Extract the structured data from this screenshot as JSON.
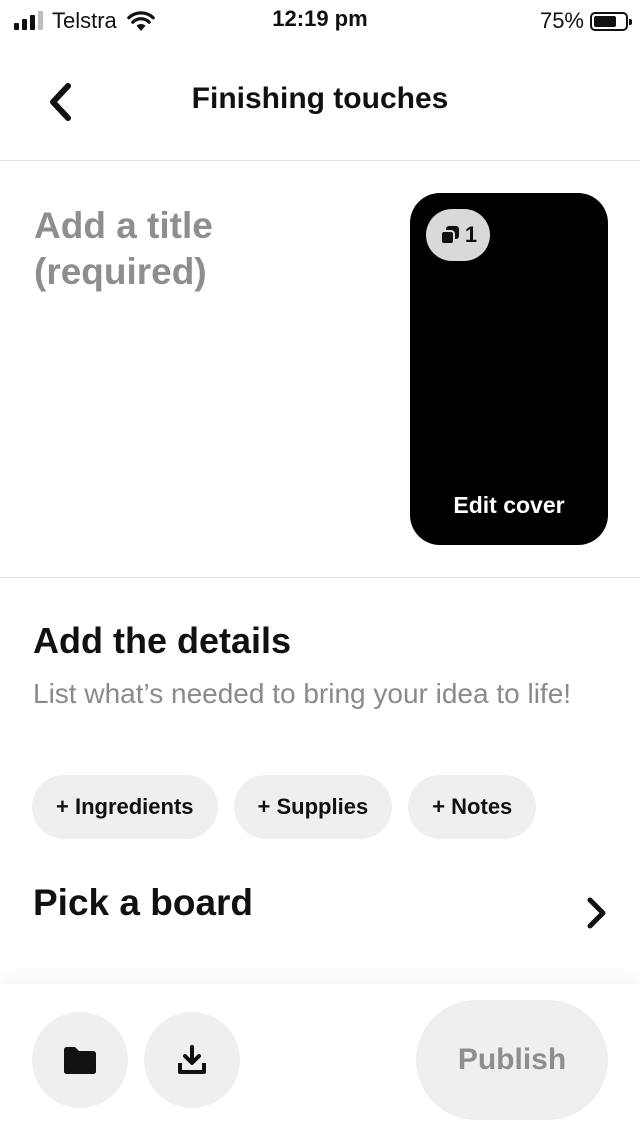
{
  "status_bar": {
    "carrier": "Telstra",
    "time": "12:19 pm",
    "battery_percent": "75%",
    "battery_level": 0.75
  },
  "header": {
    "title": "Finishing touches"
  },
  "title_field": {
    "placeholder": "Add a title\n(required)"
  },
  "cover": {
    "page_count": "1",
    "edit_label": "Edit cover"
  },
  "details": {
    "heading": "Add the details",
    "subtext": "List what’s needed to bring your idea to life!",
    "chips": [
      "+ Ingredients",
      "+ Supplies",
      "+ Notes"
    ]
  },
  "board": {
    "label": "Pick a board"
  },
  "bottom_bar": {
    "publish_label": "Publish"
  },
  "colors": {
    "chip_background": "#efefef",
    "muted_text": "#8e8e8e",
    "cover_background": "#000000"
  }
}
